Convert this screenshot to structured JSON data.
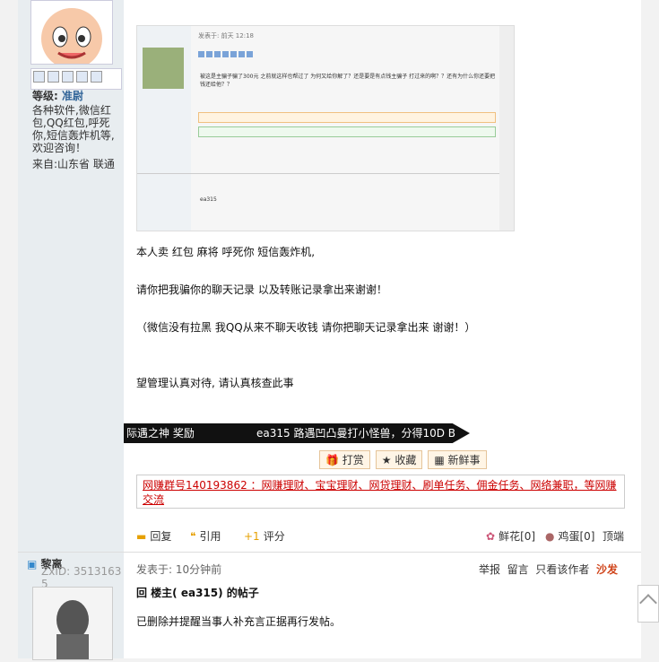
{
  "sidebar": {
    "level_label": "等级:",
    "level_value": "准尉",
    "signature": "各种软件,微信红包,QQ红包,呼死你,短信轰炸机等,欢迎咨询！",
    "location": "来自:山东省 联通"
  },
  "embedded_shot": {
    "header": "发表于: 前天 12:18",
    "body": "被这是主骗子骗了300元 之前就这样也帮过了 为何又给你解了？还是要是有点钱主骗子 打过来的啊？？还有为什么你还要把钱还给他？？",
    "username": "ea315"
  },
  "post": {
    "lines": [
      "本人卖 红包   麻将  呼死你  短信轰炸机,",
      "请你把我骗你的聊天记录 以及转账记录拿出来谢谢！",
      "（微信没有拉黑 我QQ从来不聊天收钱 请你把聊天记录拿出来 谢谢！）",
      "望管理认真对待, 请认真核查此事"
    ],
    "badge": "际遇之神  奖励",
    "badge_text": "ea315 路遇凹凸曼打小怪兽，分得10D B",
    "btn_tip": "打赏",
    "btn_fav": "收藏",
    "btn_fresh": "新鲜事",
    "ad": "网赚群号140193862 ：网赚理财、宝宝理财、网贷理财、刷单任务、佣金任务、网络兼职，等网赚交流",
    "reply": "回复",
    "quote": "引用",
    "rate": "评分",
    "flower": "鲜花[0]",
    "egg": "鸡蛋[0]",
    "top": "顶端"
  },
  "post2": {
    "username": "黎离",
    "zxid": "ZxID: 3513163",
    "zxid_tail": "5",
    "posted": "发表于: 10分钟前",
    "links": [
      "举报",
      "留言",
      "只看该作者"
    ],
    "sofa": "沙发",
    "reply_title": "回 楼主(            ea315) 的帖子",
    "reply_body": "已删除并提醒当事人补充言正据再行发帖。"
  }
}
